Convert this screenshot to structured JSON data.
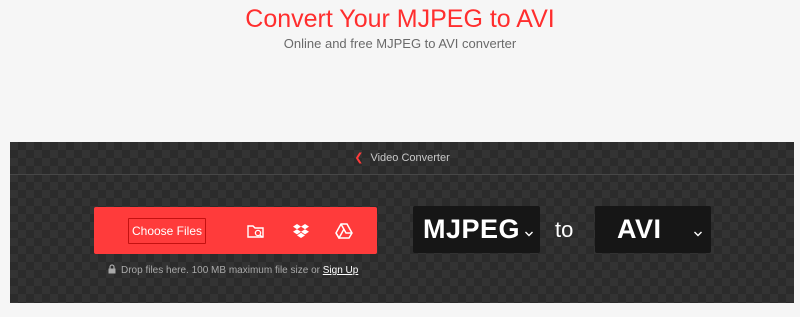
{
  "header": {
    "title": "Convert Your MJPEG to AVI",
    "subtitle": "Online and free MJPEG to AVI converter"
  },
  "breadcrumb": {
    "label": "Video Converter"
  },
  "upload": {
    "choose_label": "Choose Files",
    "sources": [
      "folder-search-icon",
      "dropbox-icon",
      "google-drive-icon"
    ],
    "drop_note": "Drop files here. 100 MB maximum file size or ",
    "signup_label": "Sign Up"
  },
  "conversion": {
    "from": "MJPEG",
    "to_word": "to",
    "to": "AVI"
  },
  "colors": {
    "accent": "#ff3b3b",
    "panel_bg": "#333333",
    "format_bg": "#161616"
  }
}
